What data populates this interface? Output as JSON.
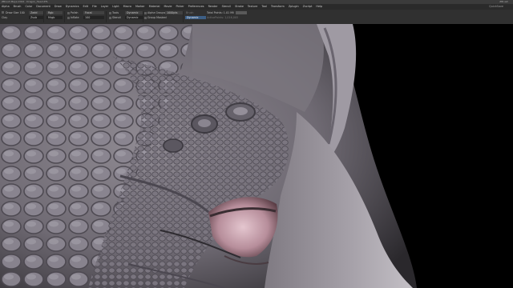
{
  "window": {
    "title": "ZBrush  Maya 2024  ·  Dragon_Head.ZTL",
    "right_text": "ZBrush"
  },
  "menu": {
    "items": [
      "Alpha",
      "Brush",
      "Color",
      "Document",
      "Draw",
      "Dynamics",
      "Edit",
      "File",
      "Layer",
      "Light",
      "Macro",
      "Marker",
      "Material",
      "Movie",
      "Picker",
      "Preferences",
      "Render",
      "Stencil",
      "Stroke",
      "Texture",
      "Tool",
      "Transform",
      "Zplugin",
      "Zscript",
      "Help"
    ],
    "right_text": "QuickSave"
  },
  "shelf": {
    "draw_size_label": "Draw Size 100",
    "focal_label": "Focal",
    "brush_label": "Clay",
    "rgb_label": "Rgb",
    "mrgb_label": "Mrgb",
    "zadd_label": "Zadd",
    "zsub_label": "Zsub",
    "polish_label": "Polish",
    "inflate_label": "Inflate",
    "tools_label": "Tools",
    "stencil_label": "Stencil",
    "alpha_groups_label": "Alpha Groups",
    "group_masked_label": "Group Masked",
    "total_points_label": "Total Points: 1.01 Mil",
    "active_points_label": "ActivePoints: 1,016,005",
    "mask_value": "1000pts",
    "dim_label_1": "Brush",
    "dim_label_2": "Scale",
    "mode_value": "Dynamic",
    "active_field": "Dynamic",
    "slider_value": "100"
  }
}
